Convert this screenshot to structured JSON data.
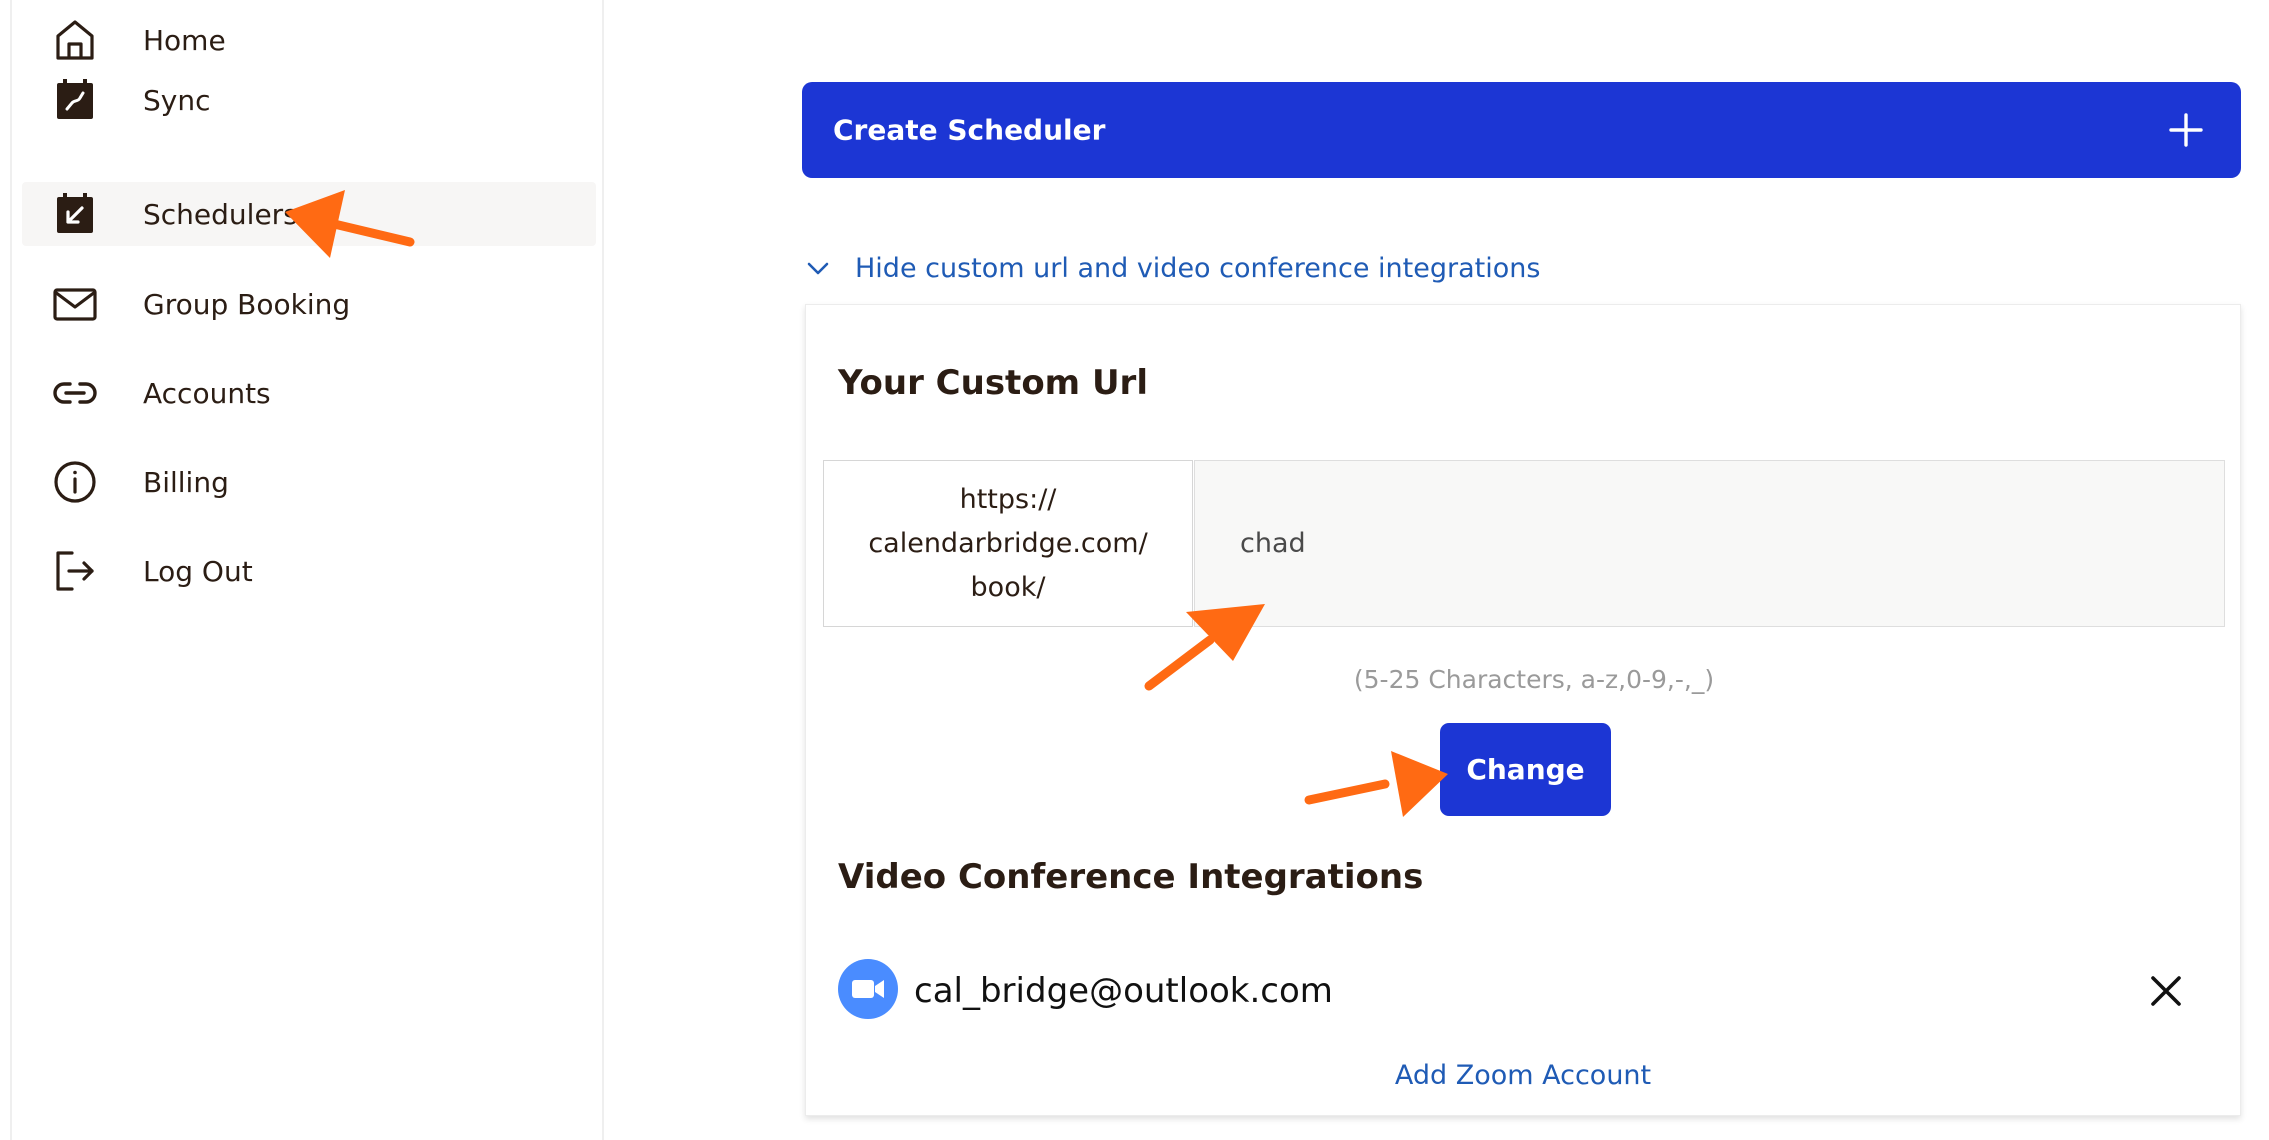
{
  "sidebar": {
    "items": [
      {
        "label": "Home",
        "icon": "home-icon"
      },
      {
        "label": "Sync",
        "icon": "calendar-sync-icon"
      },
      {
        "label": "Schedulers",
        "icon": "calendar-arrow-icon",
        "active": true
      },
      {
        "label": "Group Booking",
        "icon": "envelope-icon"
      },
      {
        "label": "Accounts",
        "icon": "link-icon"
      },
      {
        "label": "Billing",
        "icon": "info-icon"
      },
      {
        "label": "Log Out",
        "icon": "logout-icon"
      }
    ]
  },
  "main": {
    "create_button_label": "Create Scheduler",
    "toggle_label": "Hide custom url and video conference integrations",
    "custom_url": {
      "title": "Your Custom Url",
      "prefix_lines": [
        "https://",
        "calendarbridge.com/",
        "book/"
      ],
      "value": "chad",
      "hint": "(5-25 Characters, a-z,0-9,-,_)",
      "change_button": "Change"
    },
    "video": {
      "title": "Video Conference Integrations",
      "accounts": [
        {
          "email": "cal_bridge@outlook.com",
          "icon": "zoom-icon"
        }
      ],
      "add_label": "Add Zoom Account"
    }
  },
  "colors": {
    "brand_blue": "#1c36d4",
    "link_blue": "#1f5bb5",
    "zoom_blue": "#4a8cff",
    "annotation_orange": "#ff6a13",
    "text_dark": "#2b1d14"
  }
}
